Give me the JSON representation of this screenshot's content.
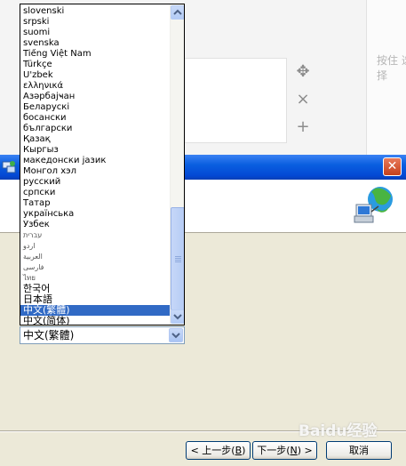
{
  "background_page": {
    "hint_text": "按住 选择"
  },
  "wizard": {
    "buttons": {
      "back_label": "< 上一步",
      "back_key": "B",
      "next_label": "下一步",
      "next_key": "N",
      "next_suffix": " >",
      "cancel_label": "取消"
    },
    "language_combo": {
      "selected_value": "中文(繁體)"
    },
    "language_list": {
      "items": [
        "slovenski",
        "srpski",
        "suomi",
        "svenska",
        "Tiếng Việt Nam",
        "Türkçe",
        "U'zbek",
        "ελληνικά",
        "Азәрбајҹан",
        "Беларускі",
        "босански",
        "български",
        "Қазақ",
        "Кыргыз",
        "македонски јазик",
        "Монгол хэл",
        "русский",
        "српски",
        "Татар",
        "українська",
        "Ўзбек",
        "עברית",
        "اردو",
        "العربية",
        "فارسی",
        "ไทย",
        "한국어",
        "日本語",
        "中文(繁體)",
        "中文(简体)"
      ],
      "selected_index": 28
    }
  },
  "watermark_text": "Baidu经验"
}
